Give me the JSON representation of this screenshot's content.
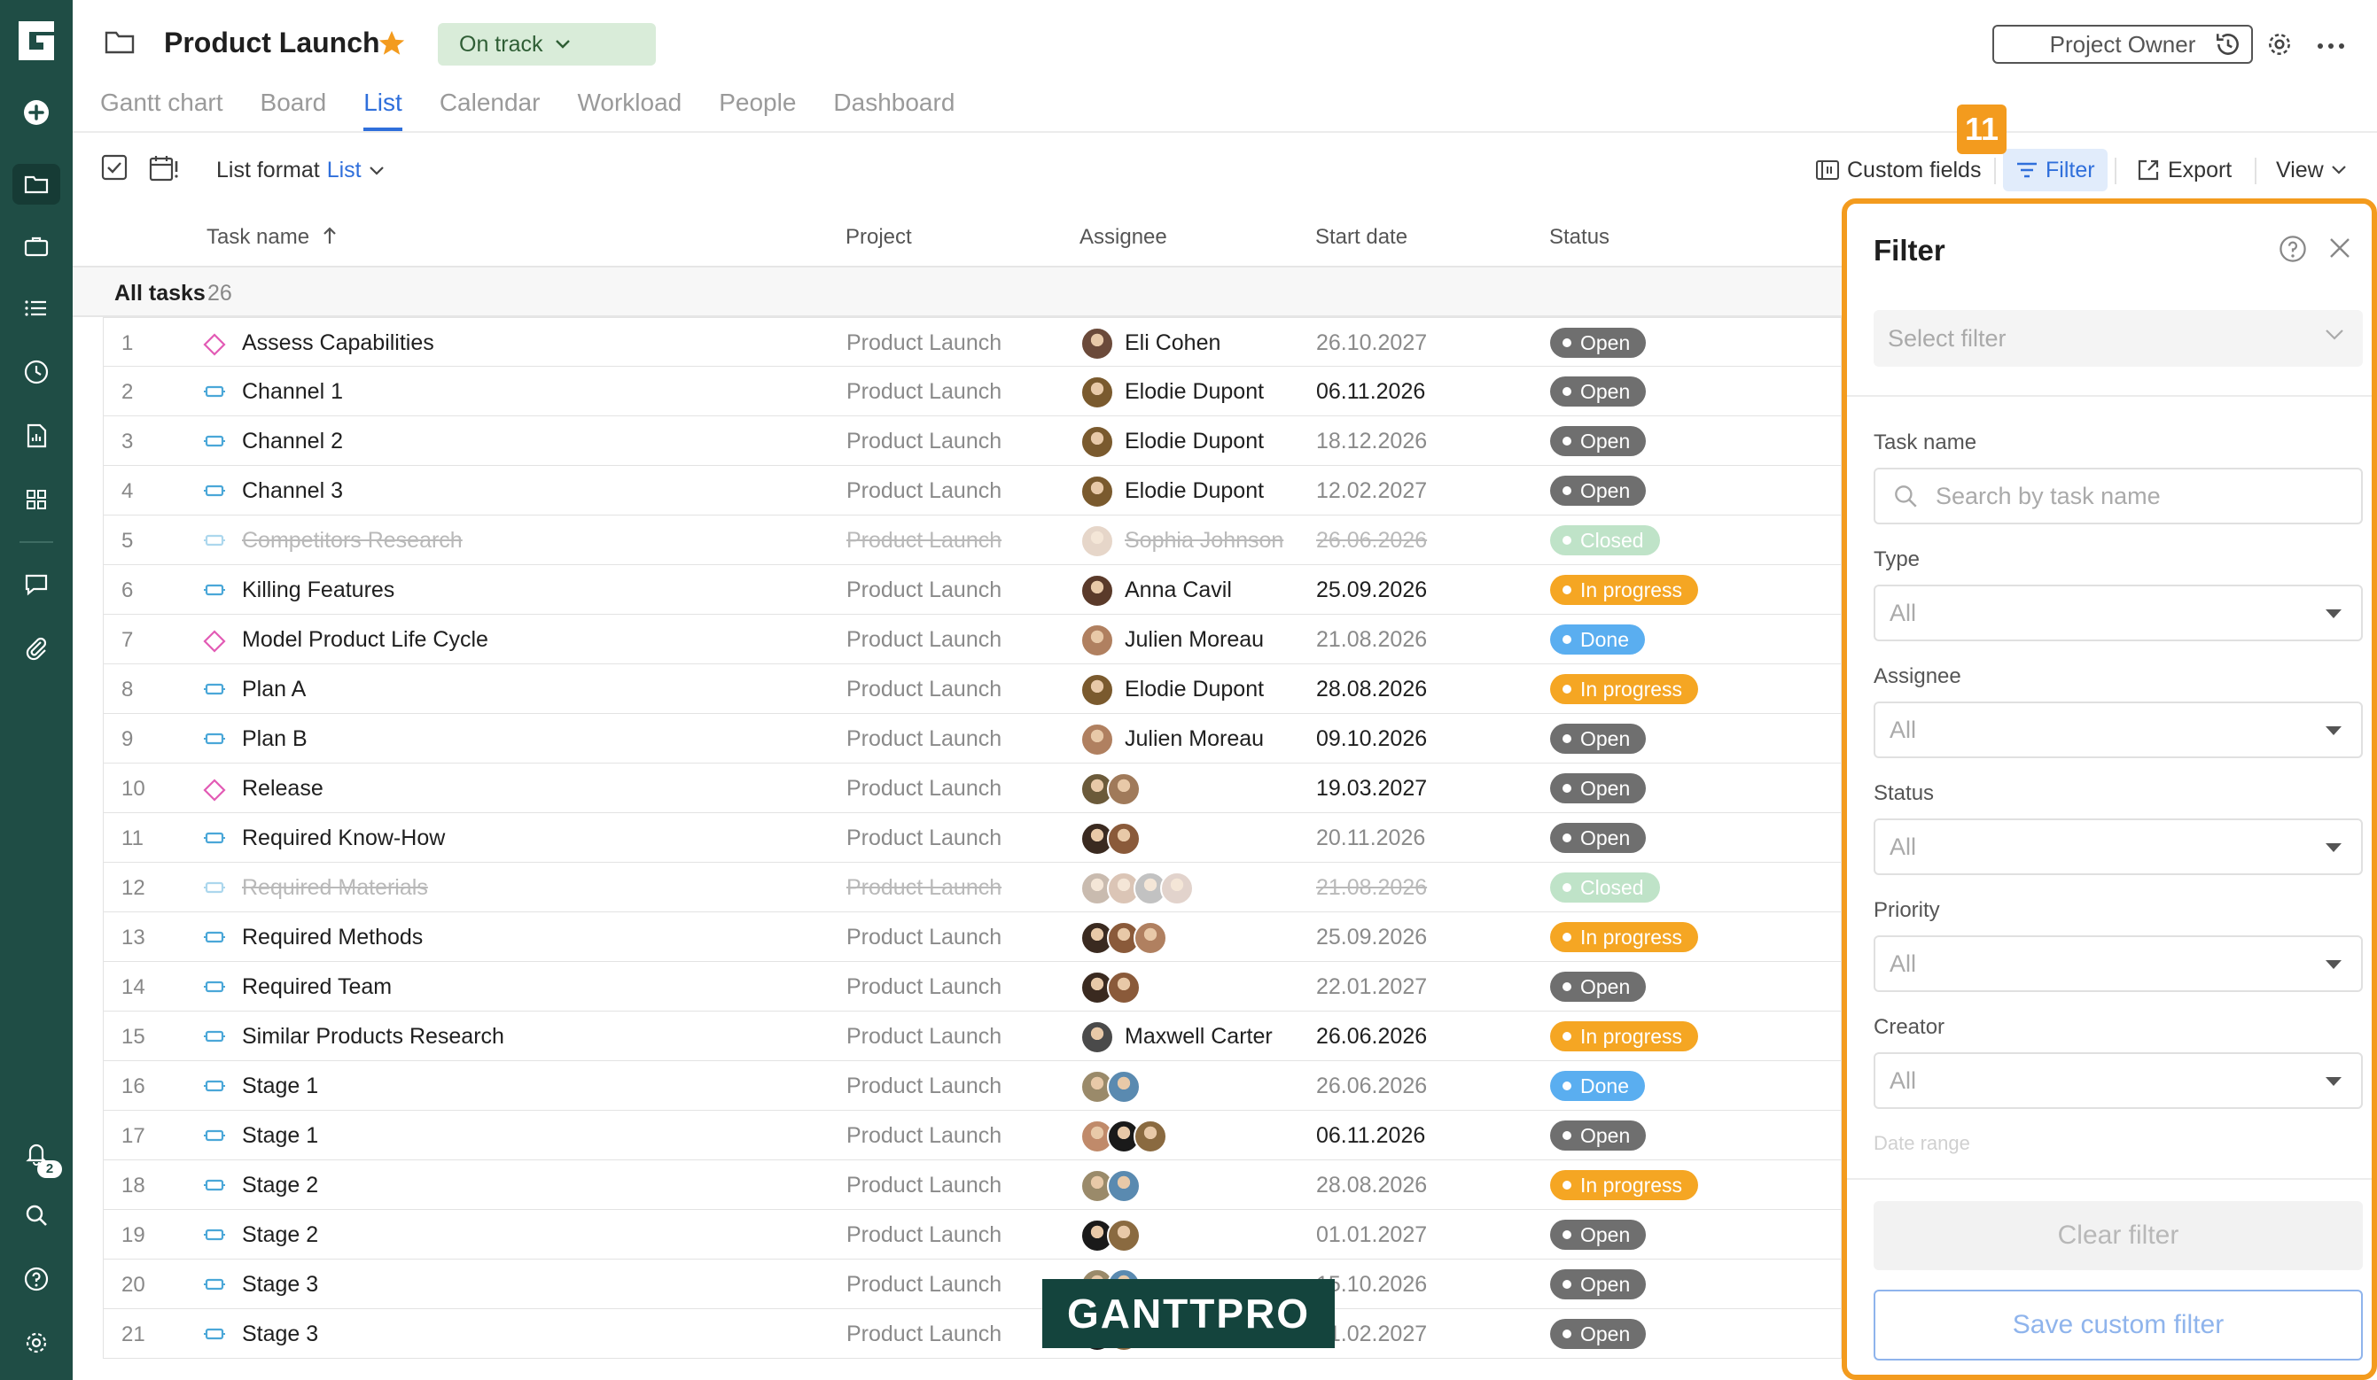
{
  "header": {
    "project_title": "Product Launch",
    "status_label": "On track",
    "owner_button": "Project Owner",
    "tabs": [
      {
        "label": "Gantt chart"
      },
      {
        "label": "Board"
      },
      {
        "label": "List"
      },
      {
        "label": "Calendar"
      },
      {
        "label": "Workload"
      },
      {
        "label": "People"
      },
      {
        "label": "Dashboard"
      }
    ],
    "active_tab": "List"
  },
  "toolbar": {
    "list_format_label": "List format",
    "list_format_value": "List",
    "custom_fields": "Custom fields",
    "filter": "Filter",
    "export": "Export",
    "view": "View",
    "step_badge": "11"
  },
  "rail": {
    "notification_count": "2"
  },
  "table": {
    "columns": {
      "task_name": "Task name",
      "project": "Project",
      "assignee": "Assignee",
      "start_date": "Start date",
      "status": "Status"
    },
    "group_label": "All tasks",
    "group_count": "26",
    "rows": [
      {
        "num": "1",
        "type": "milestone",
        "name": "Assess Capabilities",
        "project": "Product Launch",
        "avatars": [
          "#6b4a3a"
        ],
        "assignee": "Eli Cohen",
        "date": "26.10.2027",
        "date_dark": false,
        "status": "Open",
        "closed": false
      },
      {
        "num": "2",
        "type": "task",
        "name": "Channel 1",
        "project": "Product Launch",
        "avatars": [
          "#7a5a2e"
        ],
        "assignee": "Elodie Dupont",
        "date": "06.11.2026",
        "date_dark": true,
        "status": "Open",
        "closed": false
      },
      {
        "num": "3",
        "type": "task",
        "name": "Channel 2",
        "project": "Product Launch",
        "avatars": [
          "#7a5a2e"
        ],
        "assignee": "Elodie Dupont",
        "date": "18.12.2026",
        "date_dark": false,
        "status": "Open",
        "closed": false
      },
      {
        "num": "4",
        "type": "task",
        "name": "Channel 3",
        "project": "Product Launch",
        "avatars": [
          "#7a5a2e"
        ],
        "assignee": "Elodie Dupont",
        "date": "12.02.2027",
        "date_dark": false,
        "status": "Open",
        "closed": false
      },
      {
        "num": "5",
        "type": "task",
        "name": "Competitors Research",
        "project": "Product Launch",
        "avatars": [
          "#c9a58a"
        ],
        "assignee": "Sophia Johnson",
        "date": "26.06.2026",
        "date_dark": false,
        "status": "Closed",
        "closed": true
      },
      {
        "num": "6",
        "type": "task",
        "name": "Killing Features",
        "project": "Product Launch",
        "avatars": [
          "#5a3a2a"
        ],
        "assignee": "Anna Cavil",
        "date": "25.09.2026",
        "date_dark": true,
        "status": "In progress",
        "closed": false
      },
      {
        "num": "7",
        "type": "milestone",
        "name": "Model Product Life Cycle",
        "project": "Product Launch",
        "avatars": [
          "#b08060"
        ],
        "assignee": "Julien Moreau",
        "date": "21.08.2026",
        "date_dark": false,
        "status": "Done",
        "closed": false
      },
      {
        "num": "8",
        "type": "task",
        "name": "Plan A",
        "project": "Product Launch",
        "avatars": [
          "#7a5a2e"
        ],
        "assignee": "Elodie Dupont",
        "date": "28.08.2026",
        "date_dark": true,
        "status": "In progress",
        "closed": false
      },
      {
        "num": "9",
        "type": "task",
        "name": "Plan B",
        "project": "Product Launch",
        "avatars": [
          "#b08060"
        ],
        "assignee": "Julien Moreau",
        "date": "09.10.2026",
        "date_dark": true,
        "status": "Open",
        "closed": false
      },
      {
        "num": "10",
        "type": "milestone",
        "name": "Release",
        "project": "Product Launch",
        "avatars": [
          "#6b5a3a",
          "#a07a5a"
        ],
        "assignee": "",
        "date": "19.03.2027",
        "date_dark": true,
        "status": "Open",
        "closed": false
      },
      {
        "num": "11",
        "type": "task",
        "name": "Required Know-How",
        "project": "Product Launch",
        "avatars": [
          "#3a2a20",
          "#8a5a3a"
        ],
        "assignee": "",
        "date": "20.11.2026",
        "date_dark": false,
        "status": "Open",
        "closed": false
      },
      {
        "num": "12",
        "type": "task",
        "name": "Required Materials",
        "project": "Product Launch",
        "avatars": [
          "#8a6a50",
          "#b08060",
          "#7a7a7a",
          "#c0a090"
        ],
        "assignee": "",
        "date": "21.08.2026",
        "date_dark": false,
        "status": "Closed",
        "closed": true
      },
      {
        "num": "13",
        "type": "task",
        "name": "Required Methods",
        "project": "Product Launch",
        "avatars": [
          "#3a2a20",
          "#8a5a3a",
          "#b08060"
        ],
        "assignee": "",
        "date": "25.09.2026",
        "date_dark": false,
        "status": "In progress",
        "closed": false
      },
      {
        "num": "14",
        "type": "task",
        "name": "Required Team",
        "project": "Product Launch",
        "avatars": [
          "#3a2a20",
          "#8a5a3a"
        ],
        "assignee": "",
        "date": "22.01.2027",
        "date_dark": false,
        "status": "Open",
        "closed": false
      },
      {
        "num": "15",
        "type": "task",
        "name": "Similar Products Research",
        "project": "Product Launch",
        "avatars": [
          "#4a4a4a"
        ],
        "assignee": "Maxwell Carter",
        "date": "26.06.2026",
        "date_dark": true,
        "status": "In progress",
        "closed": false
      },
      {
        "num": "16",
        "type": "task",
        "name": "Stage 1",
        "project": "Product Launch",
        "avatars": [
          "#9a8a6a",
          "#5a8ab0"
        ],
        "assignee": "",
        "date": "26.06.2026",
        "date_dark": false,
        "status": "Done",
        "closed": false
      },
      {
        "num": "17",
        "type": "task",
        "name": "Stage 1",
        "project": "Product Launch",
        "avatars": [
          "#c08a6a",
          "#1a1a1a",
          "#8a6a40"
        ],
        "assignee": "",
        "date": "06.11.2026",
        "date_dark": true,
        "status": "Open",
        "closed": false
      },
      {
        "num": "18",
        "type": "task",
        "name": "Stage 2",
        "project": "Product Launch",
        "avatars": [
          "#9a8a6a",
          "#5a8ab0"
        ],
        "assignee": "",
        "date": "28.08.2026",
        "date_dark": false,
        "status": "In progress",
        "closed": false
      },
      {
        "num": "19",
        "type": "task",
        "name": "Stage 2",
        "project": "Product Launch",
        "avatars": [
          "#1a1a1a",
          "#8a6a40"
        ],
        "assignee": "",
        "date": "01.01.2027",
        "date_dark": false,
        "status": "Open",
        "closed": false
      },
      {
        "num": "20",
        "type": "task",
        "name": "Stage 3",
        "project": "Product Launch",
        "avatars": [
          "#9a8a6a",
          "#5a8ab0"
        ],
        "assignee": "",
        "date": "15.10.2026",
        "date_dark": false,
        "status": "Open",
        "closed": false
      },
      {
        "num": "21",
        "type": "task",
        "name": "Stage 3",
        "project": "Product Launch",
        "avatars": [
          "#1a1a1a",
          "#8a6a40"
        ],
        "assignee": "",
        "date": "21.02.2027",
        "date_dark": false,
        "status": "Open",
        "closed": false
      }
    ]
  },
  "status_colors": {
    "Open": "#6f6f6f",
    "Closed": "#bfe3c8",
    "In progress": "#f5a623",
    "Done": "#5aaef0"
  },
  "filter_panel": {
    "title": "Filter",
    "select_placeholder": "Select filter",
    "task_name_label": "Task name",
    "task_name_placeholder": "Search by task name",
    "type_label": "Type",
    "type_value": "All",
    "assignee_label": "Assignee",
    "assignee_value": "All",
    "status_label": "Status",
    "status_value": "All",
    "priority_label": "Priority",
    "priority_value": "All",
    "creator_label": "Creator",
    "creator_value": "All",
    "date_range_label": "Date range",
    "clear_button": "Clear filter",
    "save_button": "Save custom filter"
  },
  "watermark": "GANTTPRO",
  "colors": {
    "rail": "#1f4d45",
    "accent": "#2f6fdb",
    "highlight": "#f39b1e"
  }
}
